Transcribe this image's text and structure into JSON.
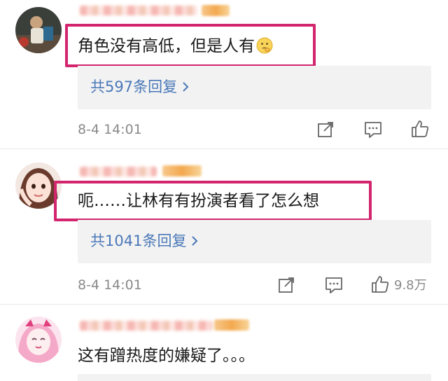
{
  "comments": [
    {
      "text": "角色没有高低，但是人有",
      "emoji": "thinking-face-emoji",
      "replies_label": "共597条回复",
      "timestamp": "8-4 14:01",
      "like_count": ""
    },
    {
      "text": "呃……让林有有扮演者看了怎么想",
      "replies_label": "共1041条回复",
      "timestamp": "8-4 14:01",
      "like_count": "9.8万"
    },
    {
      "text": "这有蹭热度的嫌疑了。。。"
    }
  ],
  "icons": {
    "share": "share-edit-icon",
    "comment": "comment-icon",
    "like": "thumbs-up-icon",
    "chevron": "chevron-right-icon"
  },
  "colors": {
    "highlight": "#d2256e",
    "link": "#4a78b8",
    "meta": "#8a8a8a",
    "reply_bg": "#f2f2f2"
  }
}
